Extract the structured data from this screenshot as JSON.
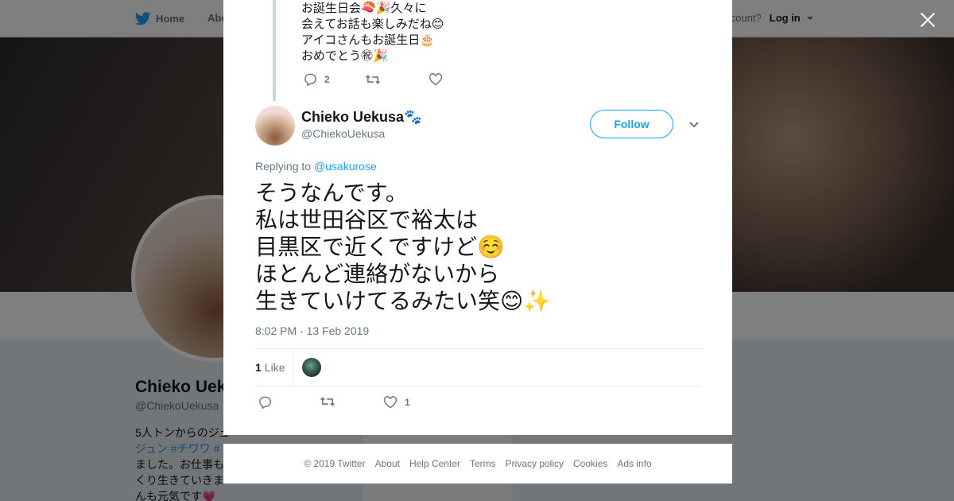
{
  "topbar": {
    "home_label": "Home",
    "about_label": "Abo",
    "account_prompt": "account?",
    "login_label": "Log in"
  },
  "profile": {
    "name": "Chieko Uek",
    "handle": "@ChiekoUekusa",
    "bio_line1": "5人トンからのジュ",
    "bio_line2_link": "ジュン #チワワ #",
    "bio_line3": "ました。お仕事も",
    "bio_line4": "くり生きていきま",
    "bio_line5": "んも元気です💗"
  },
  "previous_tweet": {
    "text": "お誕生日会🍣🎉久々に\n会えてお話も楽しみだね😊\nアイコさんもお誕生日🎂\nおめでとう㊗🎉",
    "reply_count": "2",
    "retweet_count": "",
    "like_count": ""
  },
  "tweet": {
    "author_name": "Chieko Uekusa🐾",
    "author_handle": "@ChiekoUekusa",
    "follow_label": "Follow",
    "replying_prefix": "Replying to ",
    "replying_to": "@usakurose",
    "text": "そうなんです。\n私は世田谷区で裕太は\n目黒区で近くですけど☺️\nほとんど連絡がないから\n生きていけてるみたい笑😊✨",
    "timestamp": "8:02 PM - 13 Feb 2019",
    "like_stat_count": "1",
    "like_stat_label": "Like",
    "reply_count": "",
    "retweet_count": "",
    "like_count": "1"
  },
  "footer": {
    "copyright": "© 2019 Twitter",
    "links": [
      "About",
      "Help Center",
      "Terms",
      "Privacy policy",
      "Cookies",
      "Ads info"
    ]
  },
  "colors": {
    "twitter_blue": "#1da1f2",
    "text_primary": "#14171a",
    "text_secondary": "#657786",
    "border": "#e6ecf0",
    "overlay": "rgba(0,0,0,0.5)"
  },
  "icons": {
    "close": "close-icon",
    "reply": "reply-icon",
    "retweet": "retweet-icon",
    "like": "heart-icon",
    "chevron": "chevron-down-icon",
    "bird": "twitter-bird-icon"
  }
}
